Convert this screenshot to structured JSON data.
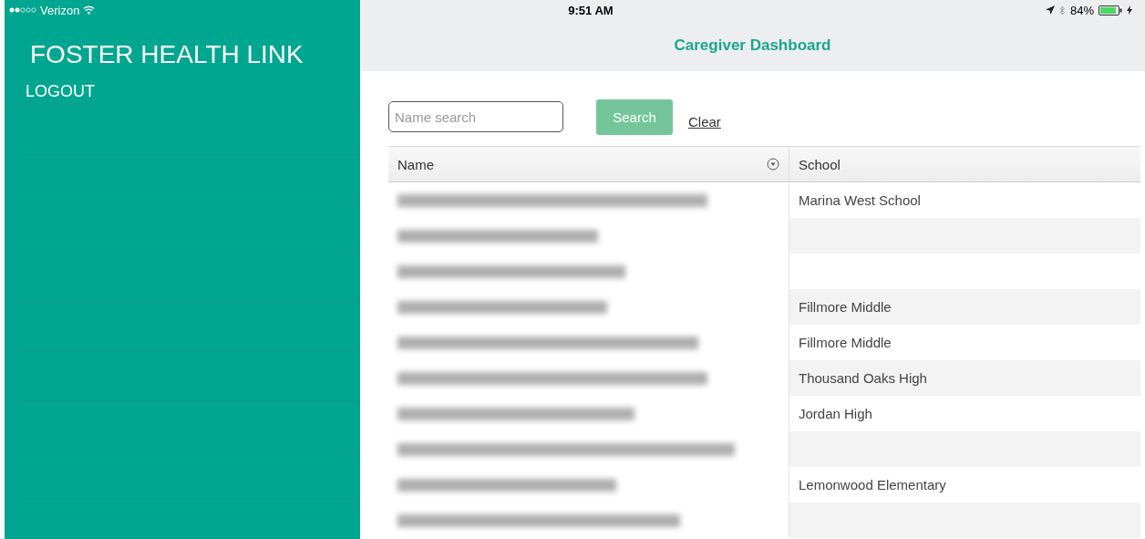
{
  "status_bar": {
    "carrier": "Verizon",
    "time": "9:51 AM",
    "battery": "84%"
  },
  "sidebar": {
    "title": "FOSTER HEALTH LINK",
    "items": [
      "LOGOUT"
    ]
  },
  "header": {
    "title": "Caregiver Dashboard"
  },
  "search": {
    "placeholder": "Name search",
    "button": "Search",
    "clear": "Clear"
  },
  "table": {
    "columns": [
      "Name",
      "School"
    ],
    "rows": [
      {
        "name": {
          "kind": "blurred"
        },
        "school": "Marina West School"
      },
      {
        "name": {
          "kind": "blurred"
        }
      },
      {
        "name": {
          "kind": "blurred"
        }
      },
      {
        "name": {
          "kind": "blurred"
        },
        "school": "Fillmore Middle"
      },
      {
        "name": {
          "kind": "blurred"
        },
        "school": "Fillmore Middle"
      },
      {
        "name": {
          "kind": "blurred"
        },
        "school": "Thousand Oaks High"
      },
      {
        "name": {
          "kind": "blurred"
        },
        "school": "Jordan High"
      },
      {
        "name": {
          "kind": "blurred"
        }
      },
      {
        "name": {
          "kind": "blurred"
        },
        "school": "Lemonwood Elementary"
      },
      {
        "name": {
          "kind": "blurred"
        }
      }
    ]
  }
}
